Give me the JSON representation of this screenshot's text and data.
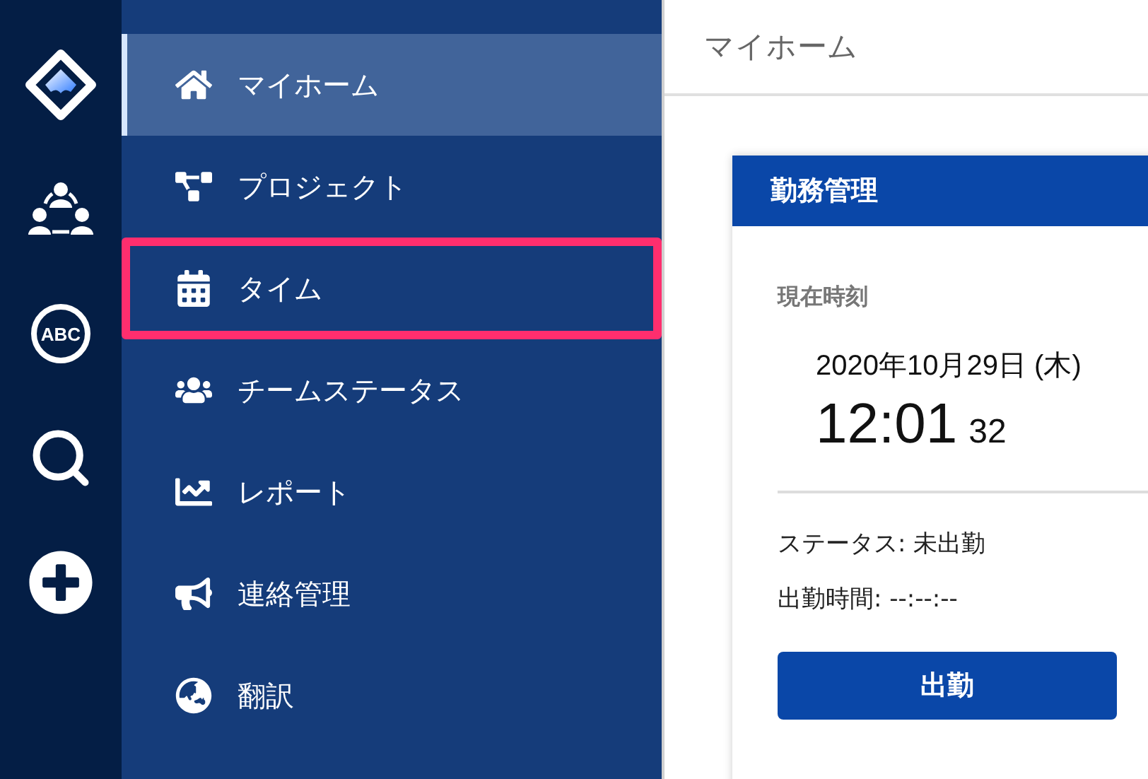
{
  "rail": [
    {
      "kind": "logo"
    },
    {
      "kind": "team"
    },
    {
      "kind": "abc",
      "label": "ABC"
    },
    {
      "kind": "search"
    },
    {
      "kind": "add"
    }
  ],
  "sidebar": {
    "items": [
      {
        "kind": "home",
        "label": "マイホーム",
        "selected": true,
        "highlighted": false
      },
      {
        "kind": "project",
        "label": "プロジェクト",
        "selected": false,
        "highlighted": false
      },
      {
        "kind": "calendar",
        "label": "タイム",
        "selected": false,
        "highlighted": true
      },
      {
        "kind": "users",
        "label": "チームステータス",
        "selected": false,
        "highlighted": false
      },
      {
        "kind": "chart",
        "label": "レポート",
        "selected": false,
        "highlighted": false
      },
      {
        "kind": "bullhorn",
        "label": "連絡管理",
        "selected": false,
        "highlighted": false
      },
      {
        "kind": "globe",
        "label": "翻訳",
        "selected": false,
        "highlighted": false
      }
    ]
  },
  "header": {
    "title": "マイホーム"
  },
  "card": {
    "title": "勤務管理",
    "clock_label": "現在時刻",
    "date": "2020年10月29日 (木)",
    "time": "12:01",
    "seconds": "32",
    "status": "ステータス: 未出勤",
    "clock_in_time": "出勤時間: --:--:--",
    "button": "出勤"
  }
}
